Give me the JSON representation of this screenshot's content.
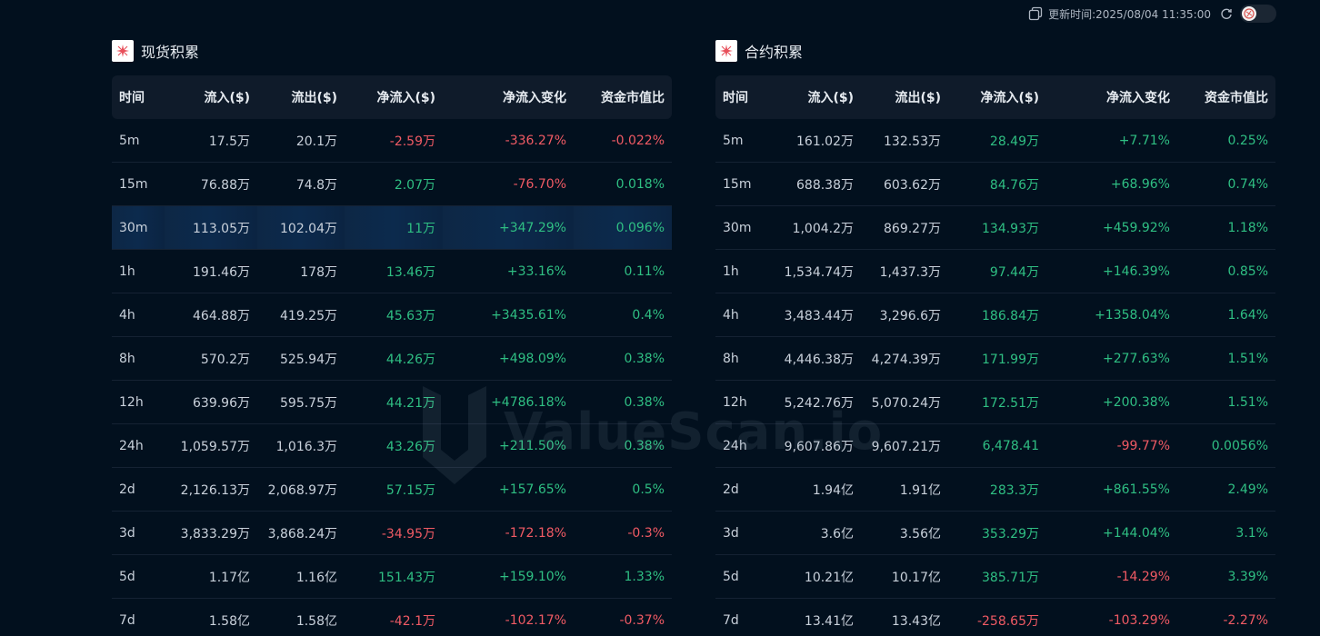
{
  "topbar": {
    "update_label": "更新时间:2025/08/04 11:35:00",
    "icons": [
      "copy-icon",
      "refresh-icon",
      "theme-toggle"
    ]
  },
  "colors": {
    "positive": "#2fbf83",
    "negative": "#f05a64",
    "background": "#02101e"
  },
  "headers": [
    "时间",
    "流入($)",
    "流出($)",
    "净流入($)",
    "净流入变化",
    "资金市值比"
  ],
  "spot": {
    "title": "现货积累",
    "highlighted_row": 2,
    "rows": [
      {
        "time": "5m",
        "inflow": "17.5万",
        "outflow": "20.1万",
        "net": "-2.59万",
        "change": "-336.27%",
        "ratio": "-0.022%"
      },
      {
        "time": "15m",
        "inflow": "76.88万",
        "outflow": "74.8万",
        "net": "2.07万",
        "change": "-76.70%",
        "ratio": "0.018%"
      },
      {
        "time": "30m",
        "inflow": "113.05万",
        "outflow": "102.04万",
        "net": "11万",
        "change": "+347.29%",
        "ratio": "0.096%"
      },
      {
        "time": "1h",
        "inflow": "191.46万",
        "outflow": "178万",
        "net": "13.46万",
        "change": "+33.16%",
        "ratio": "0.11%"
      },
      {
        "time": "4h",
        "inflow": "464.88万",
        "outflow": "419.25万",
        "net": "45.63万",
        "change": "+3435.61%",
        "ratio": "0.4%"
      },
      {
        "time": "8h",
        "inflow": "570.2万",
        "outflow": "525.94万",
        "net": "44.26万",
        "change": "+498.09%",
        "ratio": "0.38%"
      },
      {
        "time": "12h",
        "inflow": "639.96万",
        "outflow": "595.75万",
        "net": "44.21万",
        "change": "+4786.18%",
        "ratio": "0.38%"
      },
      {
        "time": "24h",
        "inflow": "1,059.57万",
        "outflow": "1,016.3万",
        "net": "43.26万",
        "change": "+211.50%",
        "ratio": "0.38%"
      },
      {
        "time": "2d",
        "inflow": "2,126.13万",
        "outflow": "2,068.97万",
        "net": "57.15万",
        "change": "+157.65%",
        "ratio": "0.5%"
      },
      {
        "time": "3d",
        "inflow": "3,833.29万",
        "outflow": "3,868.24万",
        "net": "-34.95万",
        "change": "-172.18%",
        "ratio": "-0.3%"
      },
      {
        "time": "5d",
        "inflow": "1.17亿",
        "outflow": "1.16亿",
        "net": "151.43万",
        "change": "+159.10%",
        "ratio": "1.33%"
      },
      {
        "time": "7d",
        "inflow": "1.58亿",
        "outflow": "1.58亿",
        "net": "-42.1万",
        "change": "-102.17%",
        "ratio": "-0.37%"
      }
    ]
  },
  "futures": {
    "title": "合约积累",
    "highlighted_row": -1,
    "rows": [
      {
        "time": "5m",
        "inflow": "161.02万",
        "outflow": "132.53万",
        "net": "28.49万",
        "change": "+7.71%",
        "ratio": "0.25%"
      },
      {
        "time": "15m",
        "inflow": "688.38万",
        "outflow": "603.62万",
        "net": "84.76万",
        "change": "+68.96%",
        "ratio": "0.74%"
      },
      {
        "time": "30m",
        "inflow": "1,004.2万",
        "outflow": "869.27万",
        "net": "134.93万",
        "change": "+459.92%",
        "ratio": "1.18%"
      },
      {
        "time": "1h",
        "inflow": "1,534.74万",
        "outflow": "1,437.3万",
        "net": "97.44万",
        "change": "+146.39%",
        "ratio": "0.85%"
      },
      {
        "time": "4h",
        "inflow": "3,483.44万",
        "outflow": "3,296.6万",
        "net": "186.84万",
        "change": "+1358.04%",
        "ratio": "1.64%"
      },
      {
        "time": "8h",
        "inflow": "4,446.38万",
        "outflow": "4,274.39万",
        "net": "171.99万",
        "change": "+277.63%",
        "ratio": "1.51%"
      },
      {
        "time": "12h",
        "inflow": "5,242.76万",
        "outflow": "5,070.24万",
        "net": "172.51万",
        "change": "+200.38%",
        "ratio": "1.51%"
      },
      {
        "time": "24h",
        "inflow": "9,607.86万",
        "outflow": "9,607.21万",
        "net": "6,478.41",
        "change": "-99.77%",
        "ratio": "0.0056%"
      },
      {
        "time": "2d",
        "inflow": "1.94亿",
        "outflow": "1.91亿",
        "net": "283.3万",
        "change": "+861.55%",
        "ratio": "2.49%"
      },
      {
        "time": "3d",
        "inflow": "3.6亿",
        "outflow": "3.56亿",
        "net": "353.29万",
        "change": "+144.04%",
        "ratio": "3.1%"
      },
      {
        "time": "5d",
        "inflow": "10.21亿",
        "outflow": "10.17亿",
        "net": "385.71万",
        "change": "-14.29%",
        "ratio": "3.39%"
      },
      {
        "time": "7d",
        "inflow": "13.41亿",
        "outflow": "13.43亿",
        "net": "-258.65万",
        "change": "-103.29%",
        "ratio": "-2.27%"
      }
    ]
  },
  "watermark": "ValueScan.io"
}
